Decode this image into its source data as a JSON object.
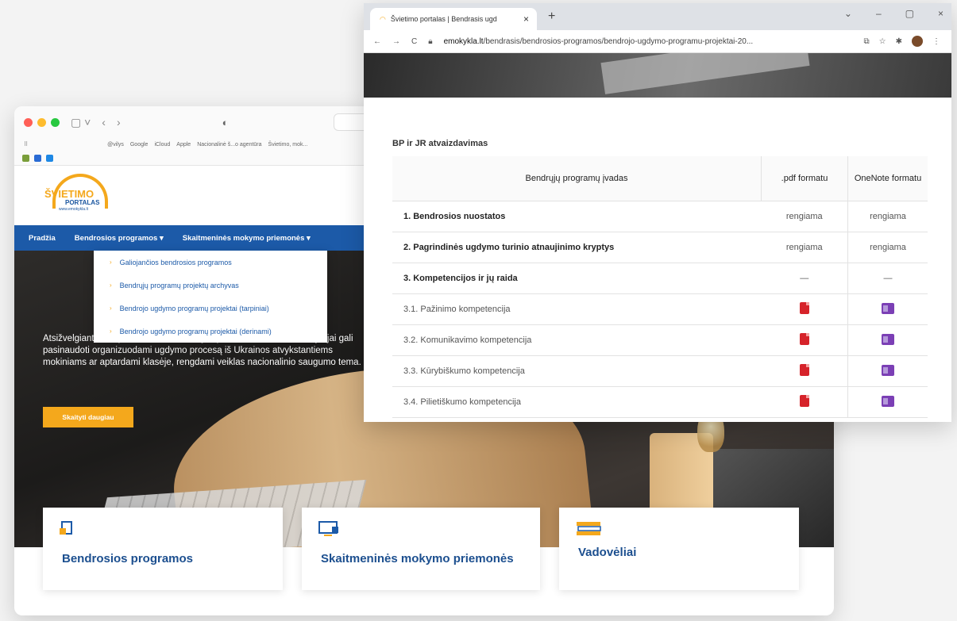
{
  "back_window": {
    "favorites": [
      "@vilys",
      "Google",
      "iCloud",
      "Apple",
      "Nacionalinė š...o agentūra",
      "Švietimo, mok..."
    ],
    "logo": {
      "line1": "ŠVIETIMO",
      "line2": "PORTALAS",
      "line3": "www.emokykla.lt"
    },
    "nav": {
      "home": "Pradžia",
      "programs": "Bendrosios programos ▾",
      "digital": "Skaitmeninės mokymo priemonės ▾"
    },
    "dropdown": [
      "Galiojančios bendrosios programos",
      "Bendrųjų programų projektų archyvas",
      "Bendrojo ugdymo programų projektai (tarpiniai)",
      "Bendrojo ugdymo programų projektai (derinami)"
    ],
    "hero_text": "Atsižvelgiant … le pateikiama informacija apie išteklius, kuriais mokytojai gali pasinaudoti organizuodami ugdymo procesą iš Ukrainos atvykstantiems mokiniams ar aptardami klasėje, rengdami veiklas nacionalinio saugumo tema.",
    "hero_button": "Skaityti daugiau",
    "cards": [
      "Bendrosios programos",
      "Skaitmeninės mokymo priemonės",
      "Vadovėliai"
    ]
  },
  "front_window": {
    "tab_title": "Švietimo portalas | Bendrasis ugd",
    "url_domain": "emokykla.lt",
    "url_path": "/bendrasis/bendrosios-programos/bendrojo-ugdymo-programu-projektai-20...",
    "section_title": "BP ir JR atvaizdavimas",
    "table": {
      "headers": [
        "Bendrųjų programų įvadas",
        ".pdf formatu",
        "OneNote formatu"
      ],
      "rows": [
        {
          "name": "1. Bendrosios nuostatos",
          "pdf": "rengiama",
          "onenote": "rengiama",
          "style": "bold"
        },
        {
          "name": "2. Pagrindinės ugdymo turinio atnaujinimo kryptys",
          "pdf": "rengiama",
          "onenote": "rengiama",
          "style": "bold"
        },
        {
          "name": "3. Kompetencijos ir jų raida",
          "pdf": "—",
          "onenote": "—",
          "style": "bold"
        },
        {
          "name": "3.1. Pažinimo kompetencija",
          "pdf": "pdf-icon",
          "onenote": "onenote-icon",
          "style": "sub"
        },
        {
          "name": "3.2. Komunikavimo kompetencija",
          "pdf": "pdf-icon",
          "onenote": "onenote-icon",
          "style": "sub"
        },
        {
          "name": "3.3. Kūrybiškumo kompetencija",
          "pdf": "pdf-icon",
          "onenote": "onenote-icon",
          "style": "sub"
        },
        {
          "name": "3.4. Pilietiškumo kompetencija",
          "pdf": "pdf-icon",
          "onenote": "onenote-icon",
          "style": "sub"
        }
      ]
    }
  },
  "colors": {
    "brand_blue": "#1c5aa8",
    "accent_orange": "#f4a81c",
    "pdf_red": "#d6232a",
    "onenote_purple": "#7b3fb5"
  }
}
